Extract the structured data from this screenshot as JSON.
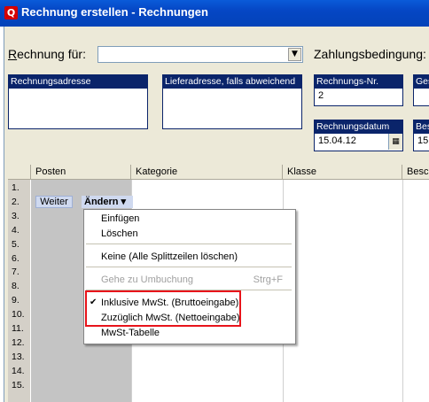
{
  "window": {
    "title": "Rechnung erstellen - Rechnungen",
    "app_icon_letter": "Q"
  },
  "header": {
    "rechnung_fuer_label": "Rechnung für:",
    "zahlungsbedingung_label": "Zahlungsbedingung:"
  },
  "boxes": {
    "rechnungsadresse": "Rechnungsadresse",
    "lieferadresse": "Lieferadresse, falls abweichend",
    "rechnungs_nr_label": "Rechnungs-Nr.",
    "rechnungs_nr_value": "2",
    "ges_label": "Ges",
    "rechnungsdatum_label": "Rechnungsdatum",
    "rechnungsdatum_value": "15.04.12",
    "bes_label": "Bes",
    "bes_value": "15"
  },
  "grid": {
    "columns": [
      "Posten",
      "Kategorie",
      "Klasse",
      "Besch"
    ],
    "rows": [
      "1.",
      "2.",
      "3.",
      "4.",
      "5.",
      "6.",
      "7.",
      "8.",
      "9.",
      "10.",
      "11.",
      "12.",
      "13.",
      "14.",
      "15."
    ]
  },
  "row_buttons": {
    "weiter": "Weiter",
    "aendern": "Ändern ▾"
  },
  "context_menu": {
    "einfuegen": "Einfügen",
    "loeschen": "Löschen",
    "keine": "Keine (Alle Splittzeilen löschen)",
    "gehe_zu": "Gehe zu Umbuchung",
    "gehe_zu_shortcut": "Strg+F",
    "inklusive": "Inklusive MwSt. (Bruttoeingabe)",
    "zuzueglich": "Zuzüglich MwSt. (Nettoeingabe)",
    "mwst_tabelle": "MwSt-Tabelle"
  },
  "colors": {
    "titlebar": "#0a5bd9",
    "highlight_border": "#e8141b",
    "selection_blue": "#0a246a"
  }
}
